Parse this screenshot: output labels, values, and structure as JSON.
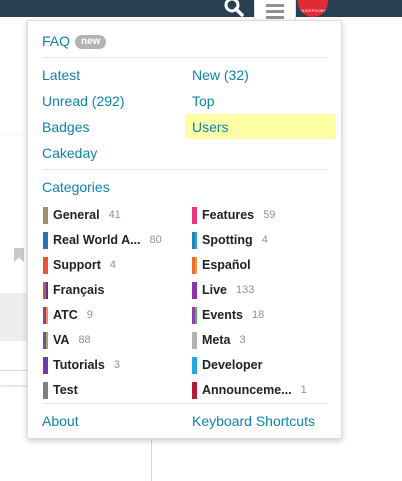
{
  "header": {
    "search_icon": "search-icon",
    "menu_icon": "hamburger-menu-icon",
    "avatar_text": "MUSEPHOBS",
    "bar_color": "#2a3f52",
    "avatar_color": "#e02b36"
  },
  "menu": {
    "faq_label": "FAQ",
    "faq_badge": "new",
    "links": {
      "latest": "Latest",
      "new": "New (32)",
      "unread": "Unread (292)",
      "top": "Top",
      "badges": "Badges",
      "users": "Users",
      "cakeday": "Cakeday"
    },
    "categories_heading": "Categories",
    "categories_left": [
      {
        "name": "General",
        "count": "41",
        "colors": [
          "#a28f6c"
        ]
      },
      {
        "name": "Real World A...",
        "count": "80",
        "colors": [
          "#2f72b1"
        ]
      },
      {
        "name": "Support",
        "count": "4",
        "colors": [
          "#e8563a"
        ]
      },
      {
        "name": "Français",
        "count": "",
        "colors": [
          "#e24b3b",
          "#3c3fa8"
        ]
      },
      {
        "name": "ATC",
        "count": "9",
        "colors": [
          "#8e3fa7",
          "#ef9633"
        ]
      },
      {
        "name": "VA",
        "count": "88",
        "colors": [
          "#8e3fa7",
          "#86be4d"
        ]
      },
      {
        "name": "Tutorials",
        "count": "3",
        "colors": [
          "#6b3ea6"
        ]
      },
      {
        "name": "Test",
        "count": "",
        "colors": [
          "#808080"
        ]
      }
    ],
    "categories_right": [
      {
        "name": "Features",
        "count": "59",
        "colors": [
          "#e6397c"
        ]
      },
      {
        "name": "Spotting",
        "count": "4",
        "colors": [
          "#2a7fbf",
          "#1bb5b0"
        ]
      },
      {
        "name": "Español",
        "count": "",
        "colors": [
          "#ef6a2f",
          "#f49a33"
        ]
      },
      {
        "name": "Live",
        "count": "133",
        "colors": [
          "#8a35a7"
        ]
      },
      {
        "name": "Events",
        "count": "18",
        "colors": [
          "#8e3fa7",
          "#4fb84a"
        ]
      },
      {
        "name": "Meta",
        "count": "3",
        "colors": [
          "#b3b3b3"
        ]
      },
      {
        "name": "Developer",
        "count": "",
        "colors": [
          "#27a9df"
        ]
      },
      {
        "name": "Announceme...",
        "count": "1",
        "colors": [
          "#b21d36"
        ]
      }
    ],
    "about": "About",
    "keyboard_shortcuts": "Keyboard Shortcuts",
    "link_color": "#0f82af",
    "highlight_color": "#ffffa6"
  }
}
